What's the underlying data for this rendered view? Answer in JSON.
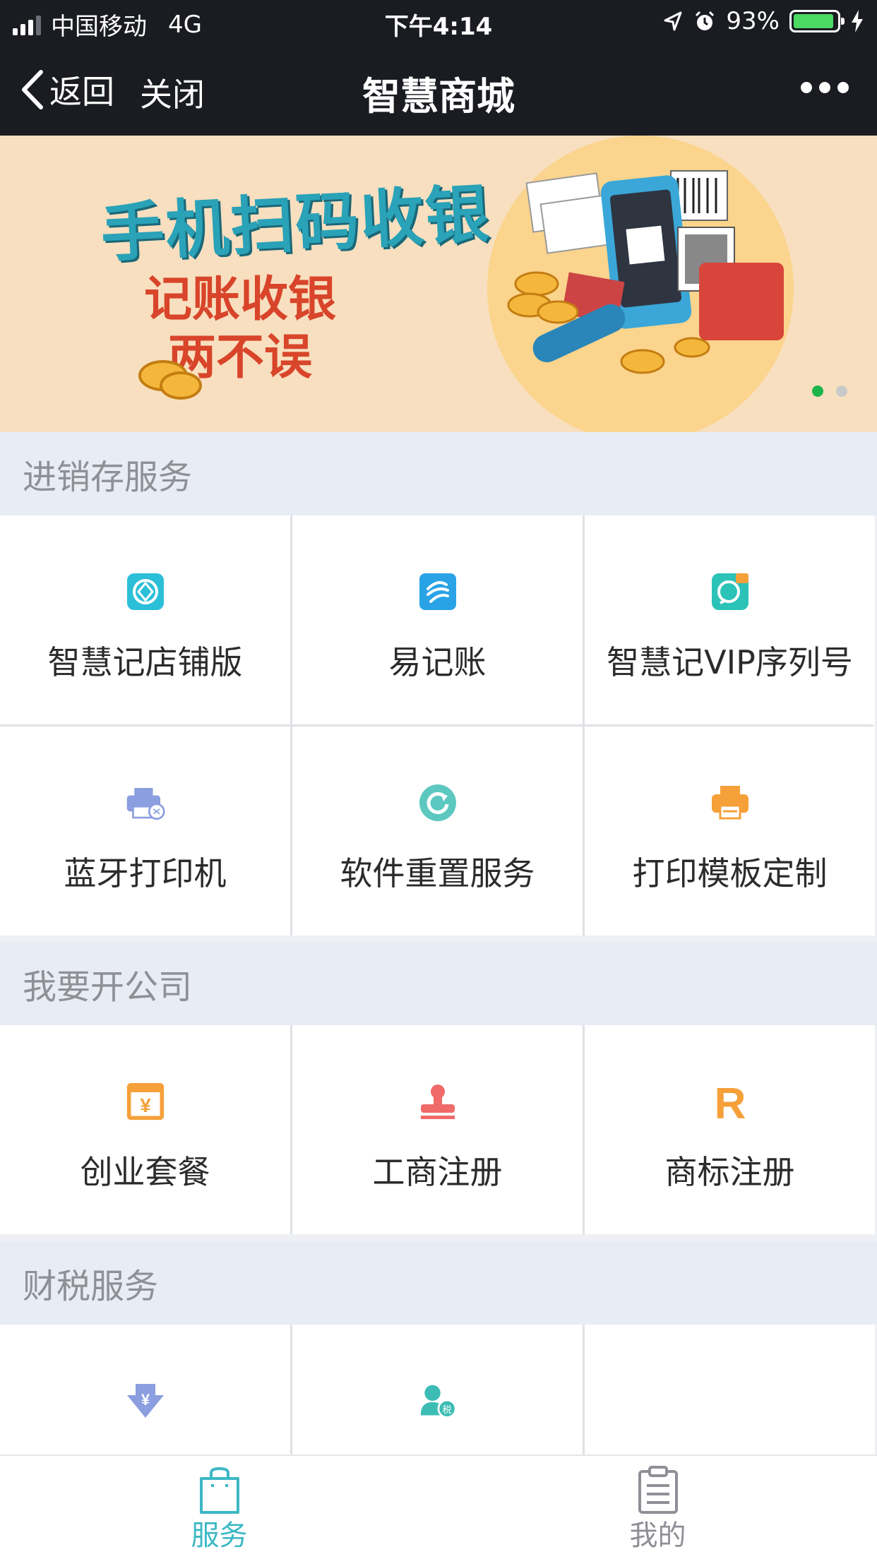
{
  "status_bar": {
    "carrier": "中国移动",
    "network": "4G",
    "time": "下午4:14",
    "battery": "93%",
    "battery_level": 0.93
  },
  "nav": {
    "back_label": "返回",
    "close_label": "关闭",
    "title": "智慧商城"
  },
  "banner": {
    "headline": "手机扫码收银",
    "subline1": "记账收银",
    "subline2": "两不误",
    "slide_count": 2,
    "active_slide": 1
  },
  "sections": [
    {
      "title": "进销存服务",
      "items": [
        {
          "label": "智慧记店铺版",
          "icon": "shop-icon"
        },
        {
          "label": "易记账",
          "icon": "ledger-icon"
        },
        {
          "label": "智慧记VIP序列号",
          "icon": "vip-icon"
        },
        {
          "label": "蓝牙打印机",
          "icon": "bluetooth-printer-icon"
        },
        {
          "label": "软件重置服务",
          "icon": "reset-icon"
        },
        {
          "label": "打印模板定制",
          "icon": "printer-icon"
        }
      ]
    },
    {
      "title": "我要开公司",
      "items": [
        {
          "label": "创业套餐",
          "icon": "package-icon"
        },
        {
          "label": "工商注册",
          "icon": "stamp-icon"
        },
        {
          "label": "商标注册",
          "icon": "trademark-icon"
        }
      ]
    },
    {
      "title": "财税服务",
      "items": [
        {
          "label": "",
          "icon": "tax-download-icon"
        },
        {
          "label": "",
          "icon": "tax-person-icon"
        },
        {
          "label": "",
          "icon": ""
        }
      ]
    }
  ],
  "tabbar": {
    "tabs": [
      {
        "label": "服务",
        "active": true,
        "icon": "bag-icon"
      },
      {
        "label": "我的",
        "active": false,
        "icon": "clipboard-icon"
      }
    ]
  },
  "colors": {
    "accent": "#3cb8c4",
    "teal": "#2bbfc4",
    "blue": "#29a3e6",
    "orange": "#f6a03a",
    "red": "#f06a6a",
    "purple": "#8a9ee0"
  }
}
